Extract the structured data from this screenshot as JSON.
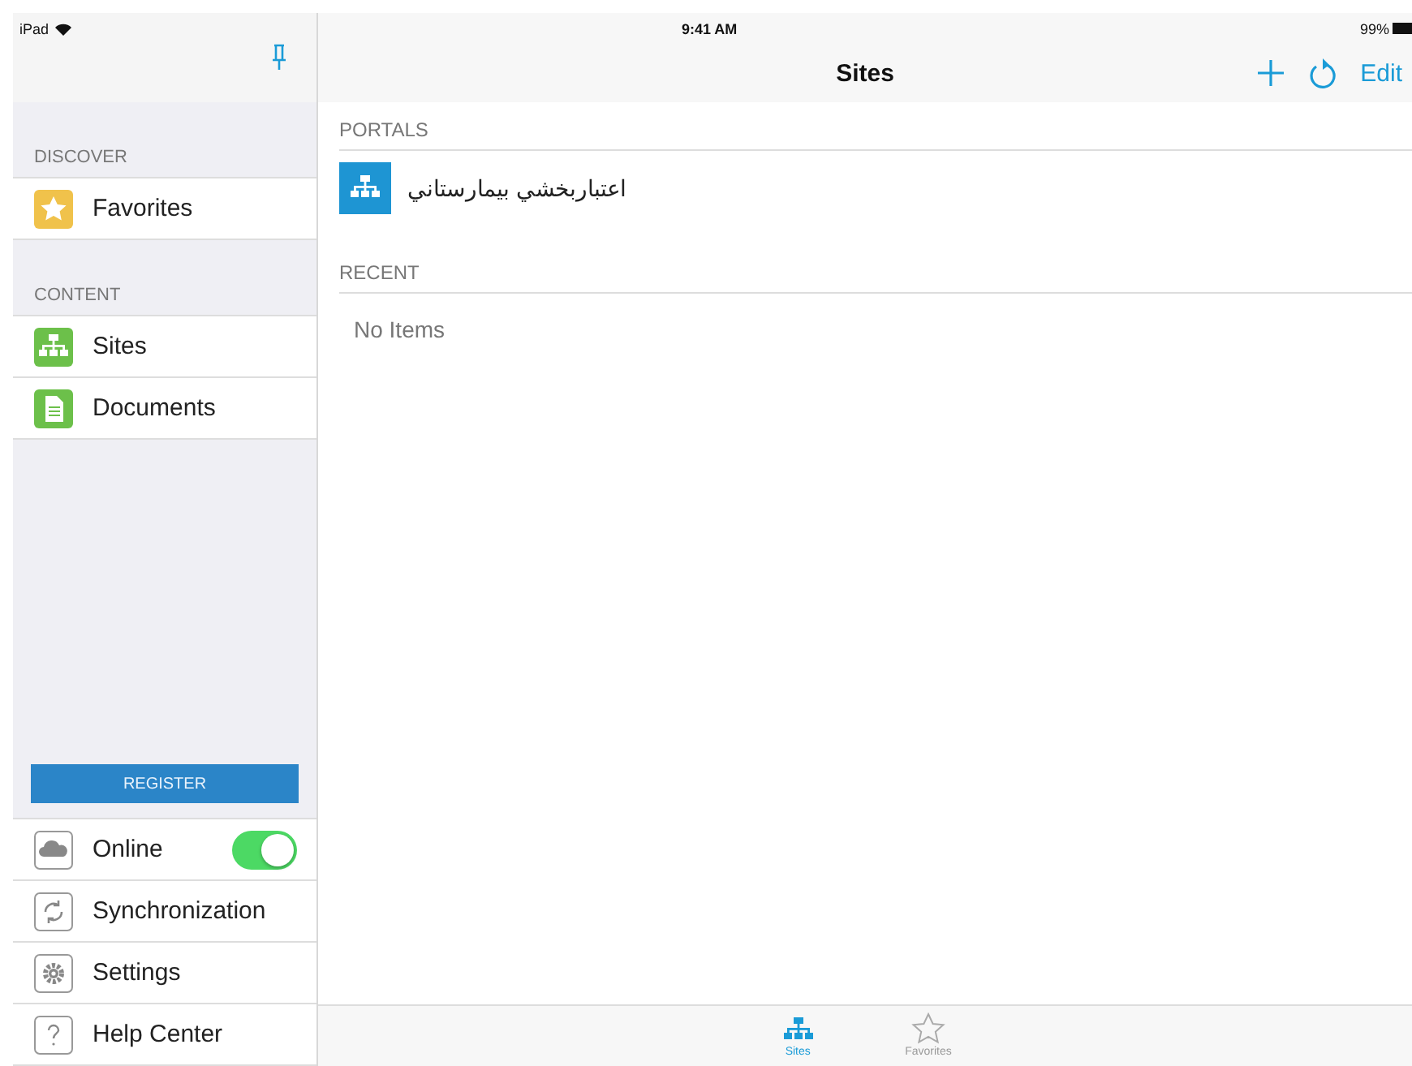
{
  "status_bar": {
    "device": "iPad",
    "time": "9:41 AM",
    "battery": "99%"
  },
  "sidebar": {
    "sections": [
      {
        "title": "DISCOVER",
        "items": [
          {
            "label": "Favorites",
            "kind": "star"
          }
        ]
      },
      {
        "title": "CONTENT",
        "items": [
          {
            "label": "Sites",
            "kind": "sites"
          },
          {
            "label": "Documents",
            "kind": "document"
          }
        ]
      }
    ],
    "register_button": "REGISTER",
    "bottom_items": [
      {
        "label": "Online",
        "kind": "cloud",
        "toggle": {
          "on": true
        }
      },
      {
        "label": "Synchronization",
        "kind": "sync"
      },
      {
        "label": "Settings",
        "kind": "gear"
      },
      {
        "label": "Help Center",
        "kind": "help"
      }
    ]
  },
  "nav_bar": {
    "title": "Sites",
    "edit_button": "Edit"
  },
  "portals": {
    "title": "PORTALS",
    "items": [
      "اعتباربخشي بيمارستاني"
    ]
  },
  "recent": {
    "title": "RECENT",
    "empty_text": "No Items"
  },
  "tab_bar": [
    {
      "label": "Sites",
      "kind": "sites",
      "selected": true
    },
    {
      "label": "Favorites",
      "kind": "star",
      "selected": false
    }
  ]
}
